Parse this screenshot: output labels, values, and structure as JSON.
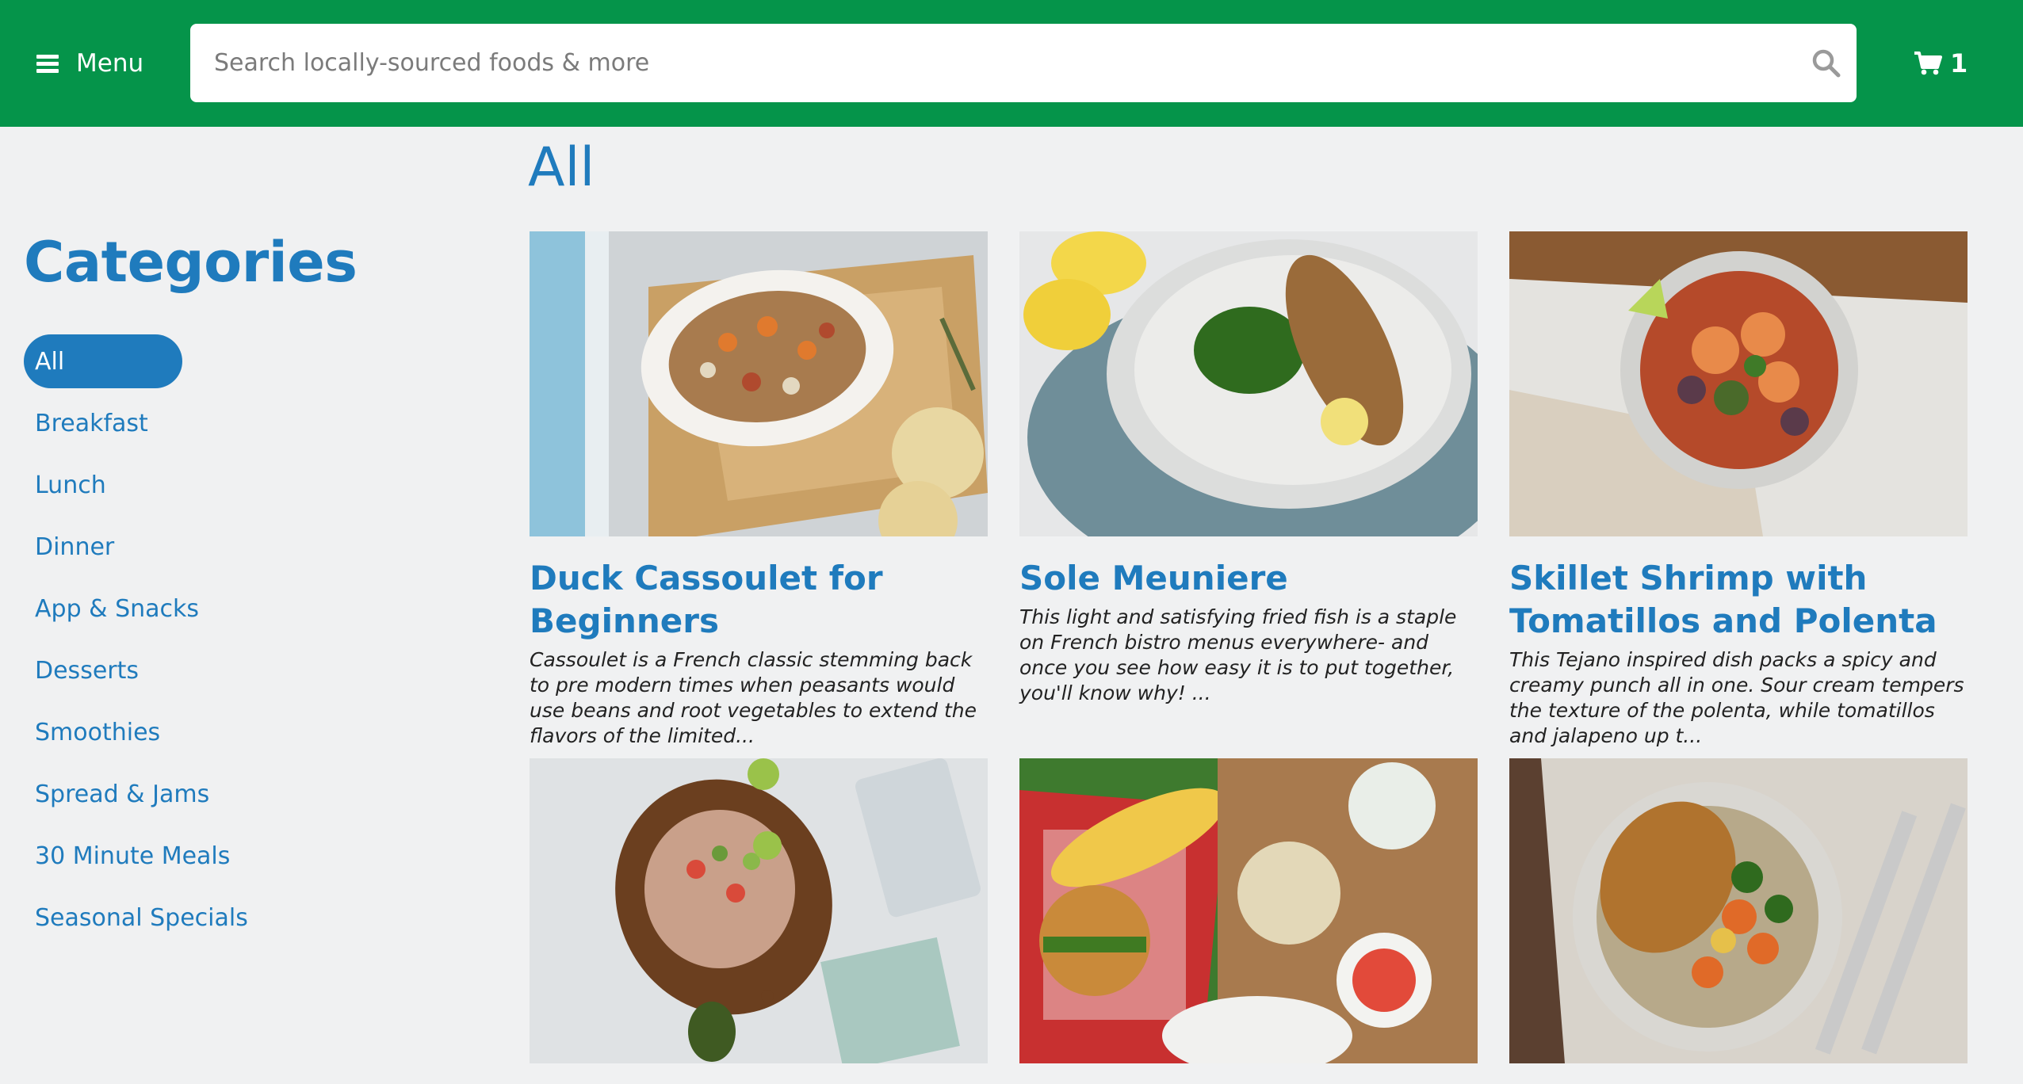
{
  "header": {
    "menu_label": "Menu",
    "search_placeholder": "Search locally-sourced foods & more",
    "cart_count": "1",
    "colors": {
      "bar": "#05944a",
      "accent": "#1f7bbd"
    }
  },
  "sidebar": {
    "title": "Categories",
    "items": [
      {
        "label": "All",
        "active": true
      },
      {
        "label": "Breakfast",
        "active": false
      },
      {
        "label": "Lunch",
        "active": false
      },
      {
        "label": "Dinner",
        "active": false
      },
      {
        "label": "App & Snacks",
        "active": false
      },
      {
        "label": "Desserts",
        "active": false
      },
      {
        "label": "Smoothies",
        "active": false
      },
      {
        "label": "Spread & Jams",
        "active": false
      },
      {
        "label": "30 Minute Meals",
        "active": false
      },
      {
        "label": "Seasonal Specials",
        "active": false
      }
    ]
  },
  "main": {
    "heading": "All",
    "recipes": [
      {
        "title": "Duck Cassoulet for Beginners",
        "description": "Cassoulet is a French classic stemming back to pre modern times when peasants would use beans and root vegetables to extend the flavors of the limited...",
        "image": "duck-cassoulet-photo"
      },
      {
        "title": "Sole Meuniere",
        "description": "This light and satisfying fried fish is a staple on French bistro menus everywhere- and once you see how easy it is to put together, you'll know why! ...",
        "image": "sole-meuniere-photo"
      },
      {
        "title": "Skillet Shrimp with Tomatillos and Polenta",
        "description": "This Tejano inspired dish packs a spicy and creamy punch all in one. Sour cream tempers the texture of the polenta, while tomatillos and jalapeno up t...",
        "image": "skillet-shrimp-photo"
      },
      {
        "title": "",
        "description": "",
        "image": "ceviche-platter-photo"
      },
      {
        "title": "",
        "description": "",
        "image": "burger-picnic-photo"
      },
      {
        "title": "",
        "description": "",
        "image": "roast-chicken-photo"
      }
    ]
  }
}
